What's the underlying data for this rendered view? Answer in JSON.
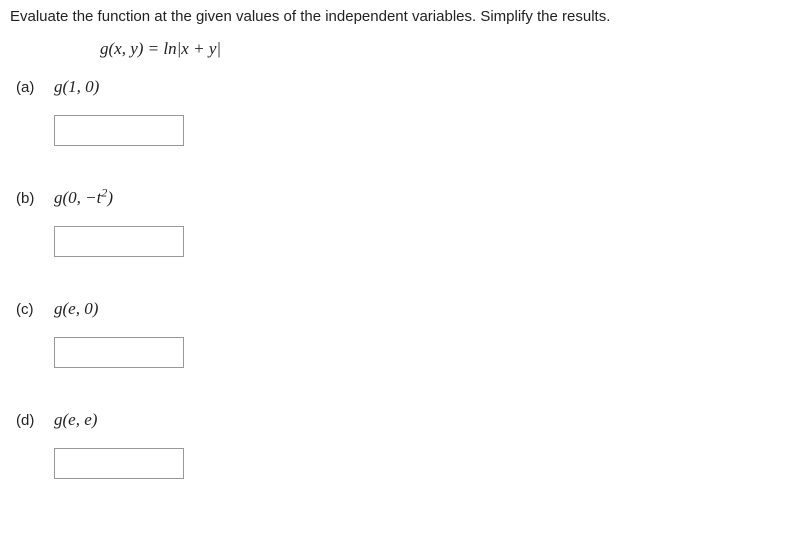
{
  "instructions": "Evaluate the function at the given values of the independent variables. Simplify the results.",
  "formula": {
    "lhs": "g(x, y)",
    "eq": " = ",
    "rhs": "ln|x + y|"
  },
  "parts": {
    "a": {
      "label": "(a)",
      "expr_html": "g(1, 0)"
    },
    "b": {
      "label": "(b)",
      "expr_html": "g(0, −t<sup>2</sup>)"
    },
    "c": {
      "label": "(c)",
      "expr_html": "g(e, 0)"
    },
    "d": {
      "label": "(d)",
      "expr_html": "g(e, e)"
    }
  }
}
